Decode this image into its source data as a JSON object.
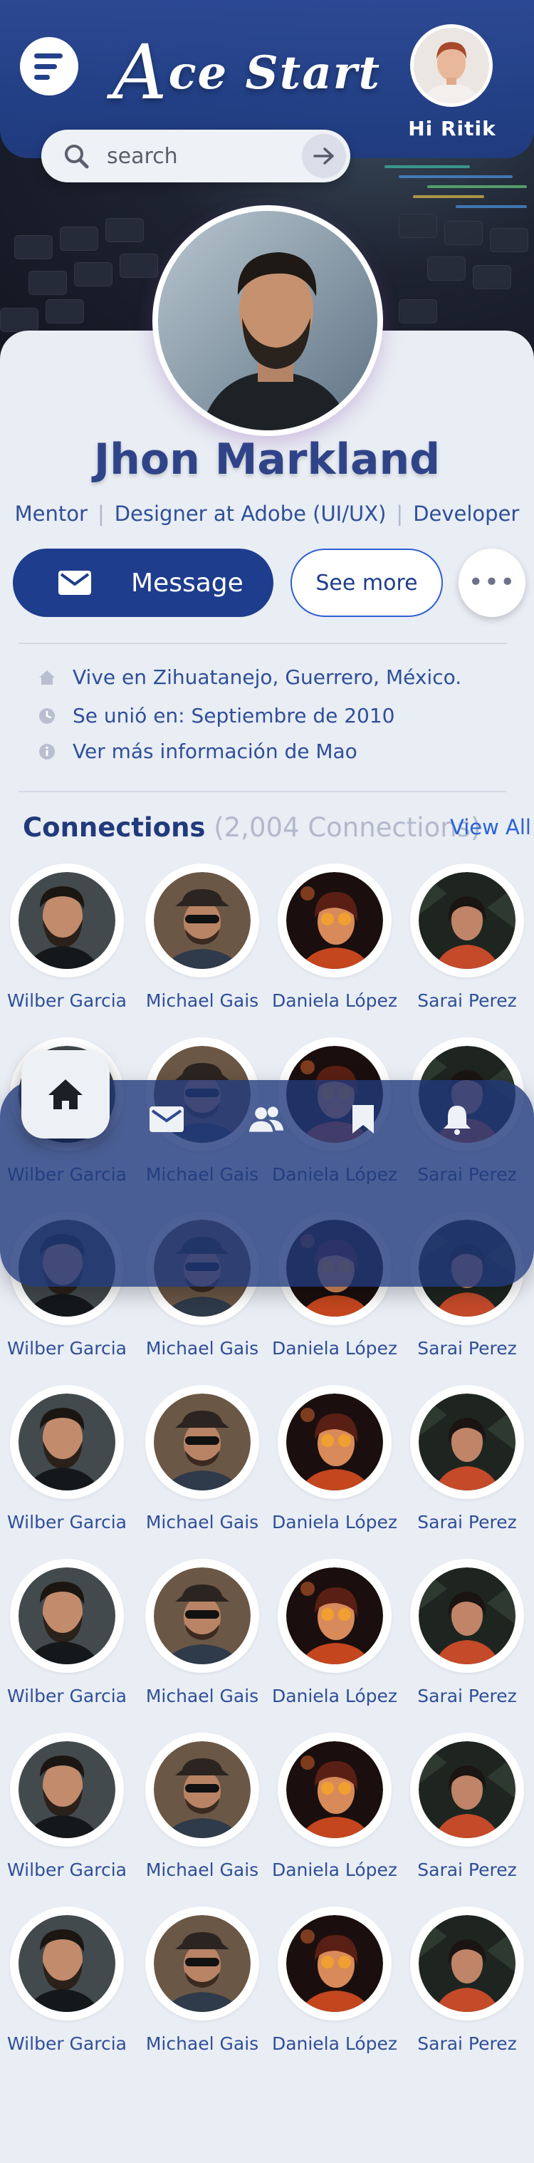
{
  "app": {
    "title_initial": "A",
    "title_rest": "ce Start",
    "greeting": "Hi Ritik"
  },
  "search": {
    "placeholder": "search"
  },
  "profile": {
    "name": "Jhon Markland",
    "roles": [
      "Mentor",
      "Designer at Adobe (UI/UX)",
      "Developer"
    ],
    "message_label": "Message",
    "see_more_label": "See more",
    "more_options_label": "•••",
    "info": [
      {
        "icon": "home-icon",
        "text": "Vive en Zihuatanejo, Guerrero, México."
      },
      {
        "icon": "clock-icon",
        "text": "Se unió en: Septiembre de 2010"
      },
      {
        "icon": "info-icon",
        "text": "Ver más información de Mao"
      }
    ]
  },
  "connections": {
    "title": "Connections",
    "count": "(2,004 Connections)",
    "view_all": "View All",
    "people": [
      {
        "name": "Wilber Garcia"
      },
      {
        "name": "Michael Gais"
      },
      {
        "name": "Daniela López"
      },
      {
        "name": "Sarai Perez"
      }
    ]
  },
  "nav": {
    "items": [
      "home-icon",
      "mail-icon",
      "people-icon",
      "bookmark-icon",
      "bell-icon"
    ],
    "active": "home-icon"
  },
  "colors": {
    "primary": "#1f3d8d",
    "accent": "#2a63d6",
    "text": "#2f4f98",
    "muted": "#b1b9cc"
  }
}
